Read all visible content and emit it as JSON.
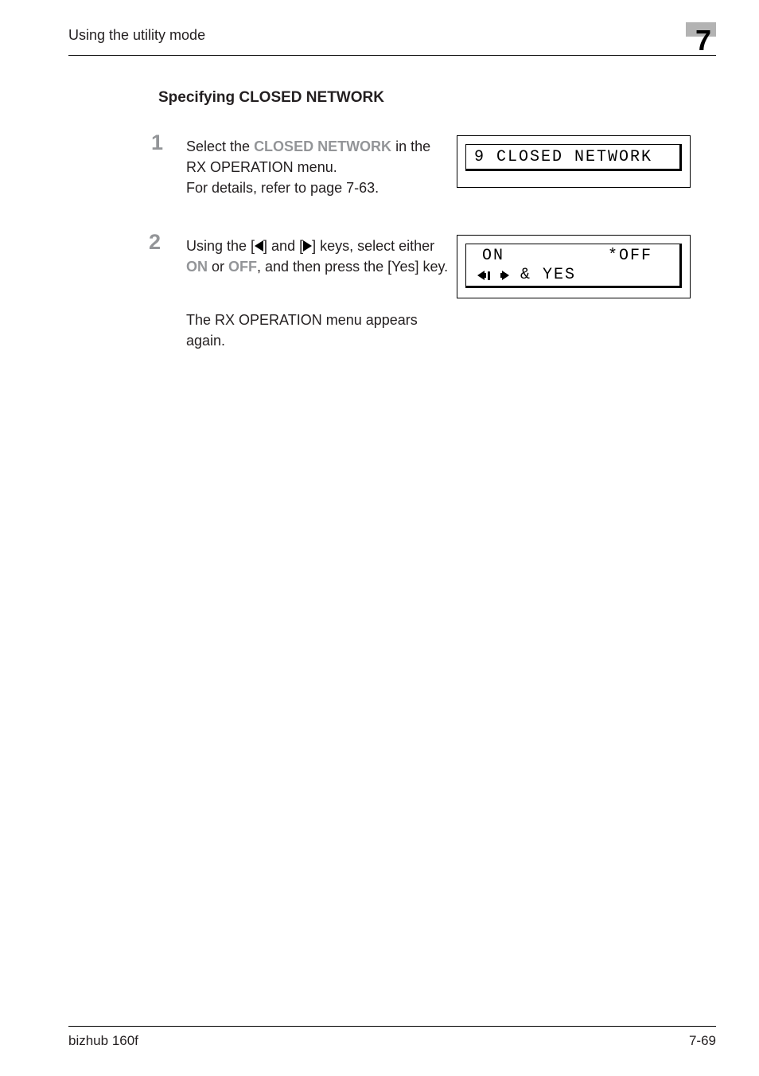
{
  "header": {
    "section_label": "Using the utility mode",
    "chapter_num": "7"
  },
  "section": {
    "heading": "Specifying CLOSED NETWORK"
  },
  "step1": {
    "num": "1",
    "pre": "Select the ",
    "kw": "CLOSED NETWORK",
    "post": " in the RX OPERATION menu.\nFor details, refer to page 7-63."
  },
  "lcd1": {
    "text": "9 CLOSED NETWORK"
  },
  "step2": {
    "num": "2",
    "pre": "Using the [",
    "mid1": "] and [",
    "mid2": "] keys, select either ",
    "kw_on": "ON",
    "or_txt": " or ",
    "kw_off": "OFF",
    "post": ", and then press the [Yes] key.",
    "result": "The RX OPERATION menu appears again."
  },
  "lcd2": {
    "on_label": "ON",
    "off_label": "*OFF",
    "line2_text": " & YES"
  },
  "footer": {
    "left": "bizhub 160f",
    "right": "7-69"
  }
}
